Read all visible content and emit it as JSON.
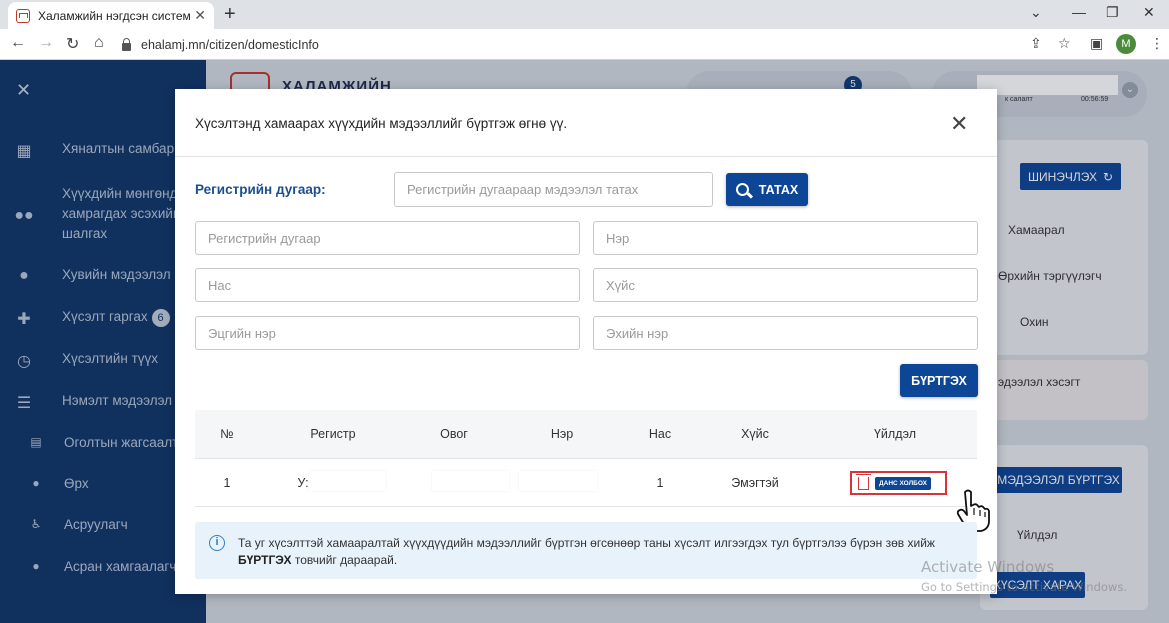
{
  "browser": {
    "tab_title": "Халамжийн нэгдсэн систем",
    "url": "ehalamj.mn/citizen/domesticInfo",
    "profile_initial": "M",
    "new_tab": "+",
    "minimize": "⌄",
    "tab_close": "✕"
  },
  "sidebar": {
    "items": [
      {
        "icon": "dashboard-icon",
        "label": "Хяналтын самбар"
      },
      {
        "icon": "users-icon",
        "label": "Хүүхдийн мөнгөнд хамрагдах эсэхийг шалгах"
      },
      {
        "icon": "user-icon",
        "label": "Хувийн мэдээлэл"
      },
      {
        "icon": "plus-icon",
        "label": "Хүсэлт гаргах",
        "badge": "6"
      },
      {
        "icon": "history-icon",
        "label": "Хүсэлтийн түүх"
      },
      {
        "icon": "list-icon",
        "label": "Нэмэлт мэдээлэл"
      },
      {
        "icon": "doc-icon",
        "label": "Оголтын жагсаалт"
      },
      {
        "icon": "person-icon",
        "label": "Өрх"
      },
      {
        "icon": "walker-icon",
        "label": "Асруулагч"
      },
      {
        "icon": "guardian-icon",
        "label": "Асран хамгаалагч"
      }
    ]
  },
  "header": {
    "title": "ХАЛАМЖИЙН",
    "notification_count": "5",
    "tiny_left": "к салалт",
    "tiny_right": "00:56:59"
  },
  "background": {
    "refresh_label": "ШИНЭЧЛЭХ",
    "rows": [
      "Хамаарал",
      "Өрхийн тэргүүлэгч",
      "Охин"
    ],
    "section_text": "эдээлэл хэсэгт",
    "register_info_label": "МЭДЭЭЛЭЛ БҮРТГЭХ",
    "action_col": "Үйлдэл",
    "view_request_label": "ХҮСЭЛТ ХАРАХ"
  },
  "watermark": {
    "title": "Activate Windows",
    "subtitle": "Go to Settings to activate Windows."
  },
  "modal": {
    "title": "Хүсэлтэнд хамаарах хүүхдийн мэдээллийг бүртгэж өгнө үү.",
    "close": "✕",
    "register_label": "Регистрийн дугаар:",
    "register_search_placeholder": "Регистрийн дугаараар мэдээлэл татах",
    "fetch_button": "ТАТАХ",
    "fields": {
      "register_placeholder": "Регистрийн дугаар",
      "name_placeholder": "Нэр",
      "age_placeholder": "Нас",
      "gender_placeholder": "Хүйс",
      "family_name_placeholder": "Эцгийн нэр",
      "mother_name_placeholder": "Эхийн нэр"
    },
    "save_button": "БҮРТГЭХ",
    "table": {
      "headers": [
        "№",
        "Регистр",
        "Овог",
        "Нэр",
        "Нас",
        "Хүйс",
        "Үйлдэл"
      ],
      "rows": [
        {
          "no": "1",
          "register": "У:",
          "surname": "",
          "name": "",
          "age": "1",
          "gender": "Эмэгтэй",
          "action": "ДАНС ХОЛБОХ"
        }
      ]
    },
    "info": {
      "text": "Та уг хүсэлттэй хамааралтай хүүхдүүдийн мэдээллийг бүртгэн өгсөнөөр таны хүсэлт илгээгдэх тул бүртгэлээ бүрэн зөв хийж ",
      "bold": "БҮРТГЭХ",
      "text2": " товчийг дараарай."
    }
  }
}
